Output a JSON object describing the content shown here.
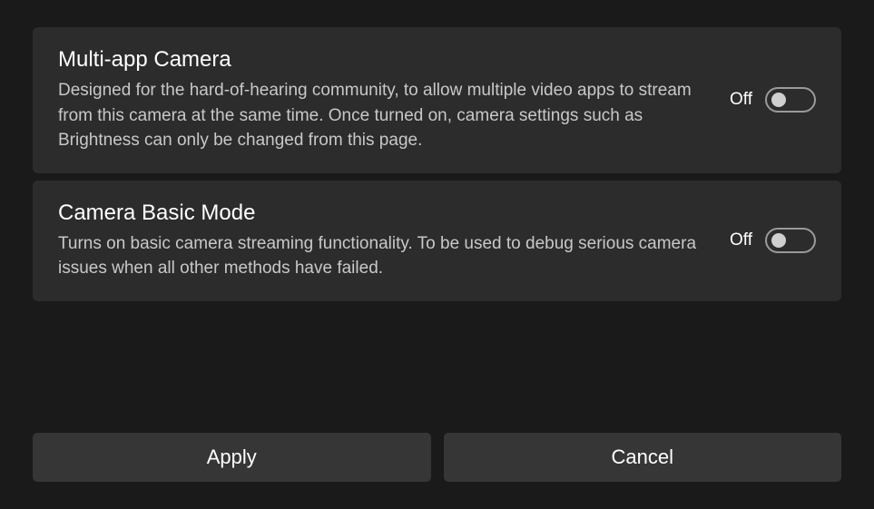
{
  "settings": [
    {
      "title": "Multi-app Camera",
      "description": "Designed for the hard-of-hearing community, to allow multiple video apps to stream from this camera at the same time. Once turned on, camera settings such as Brightness can only be changed from this page.",
      "state": "Off"
    },
    {
      "title": "Camera Basic Mode",
      "description": "Turns on basic camera streaming functionality. To be used to debug serious camera issues when all other methods have failed.",
      "state": "Off"
    }
  ],
  "buttons": {
    "apply": "Apply",
    "cancel": "Cancel"
  }
}
